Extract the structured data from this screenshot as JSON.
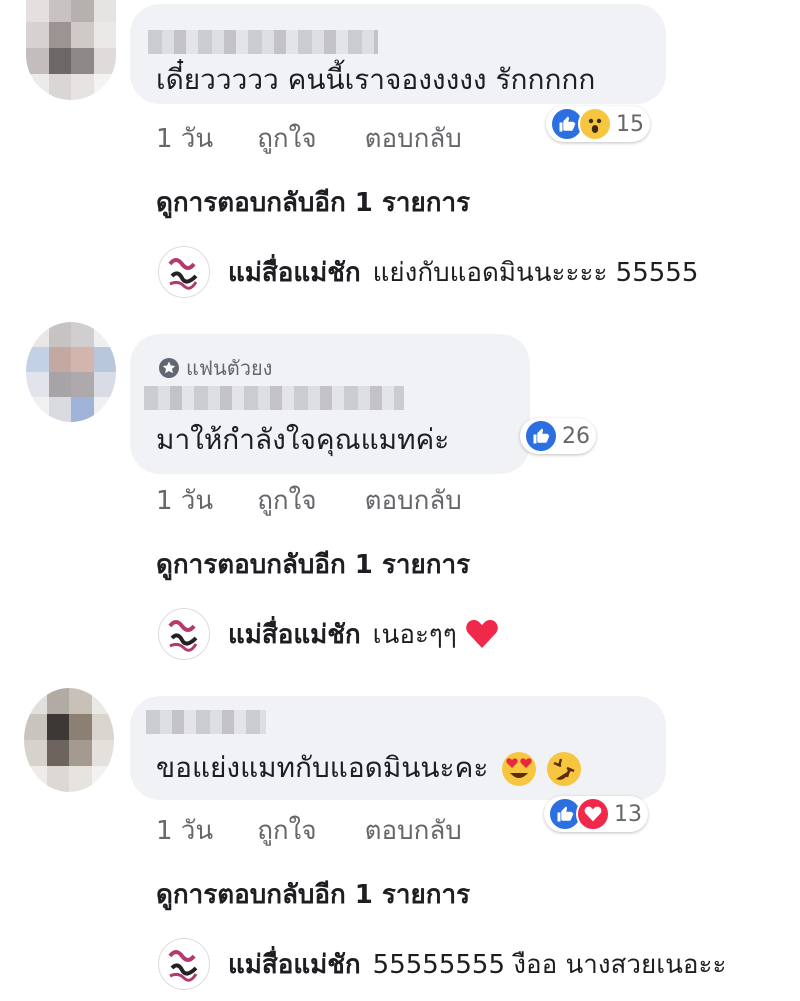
{
  "comments": [
    {
      "text": "เดี๋ยววววว คนนี้เราจองงงงง รักกกกก",
      "time": "1 วัน",
      "like_label": "ถูกใจ",
      "reply_label": "ตอบกลับ",
      "reaction_count": "15",
      "reactions": [
        "like",
        "wow"
      ],
      "more_replies": "ดูการตอบกลับอีก 1 รายการ",
      "reply": {
        "author": "แม่สื่อแม่ชัก",
        "text": "แย่งกับแอดมินนะะะะ 55555"
      }
    },
    {
      "badge": "แฟนตัวยง",
      "text": "มาให้กำลังใจคุณแมทค่ะ",
      "time": "1 วัน",
      "like_label": "ถูกใจ",
      "reply_label": "ตอบกลับ",
      "reaction_count": "26",
      "reactions": [
        "like"
      ],
      "more_replies": "ดูการตอบกลับอีก 1 รายการ",
      "reply": {
        "author": "แม่สื่อแม่ชัก",
        "text": "เนอะๆๆ",
        "emoji": "heart"
      }
    },
    {
      "text": "ขอแย่งแมทกับแอดมินนะคะ",
      "emojis": [
        "heart-eyes",
        "rofl"
      ],
      "time": "1 วัน",
      "like_label": "ถูกใจ",
      "reply_label": "ตอบกลับ",
      "reaction_count": "13",
      "reactions": [
        "like",
        "love"
      ],
      "more_replies": "ดูการตอบกลับอีก 1 รายการ",
      "reply": {
        "author": "แม่สื่อแม่ชัก",
        "text": "55555555 งืออ นางสวยเนอะะ"
      }
    }
  ],
  "colors": {
    "bubble": "#f1f2f6",
    "like": "#2b6fe0",
    "love": "#f0284a",
    "wow": "#f7c640",
    "muted_text": "#65676b"
  }
}
